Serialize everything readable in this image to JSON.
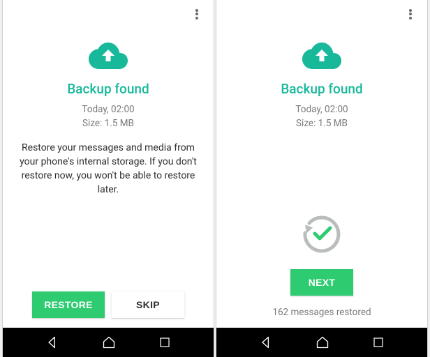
{
  "colors": {
    "accent": "#18b89a",
    "primaryBtn": "#2ecb71"
  },
  "left": {
    "title": "Backup found",
    "time": "Today, 02:00",
    "size": "Size: 1.5 MB",
    "body": "Restore your messages and media from your phone's internal storage. If you don't restore now, you won't be able to restore later.",
    "restore": "RESTORE",
    "skip": "SKIP"
  },
  "right": {
    "title": "Backup found",
    "time": "Today, 02:00",
    "size": "Size: 1.5 MB",
    "next": "NEXT",
    "status": "162 messages restored"
  }
}
